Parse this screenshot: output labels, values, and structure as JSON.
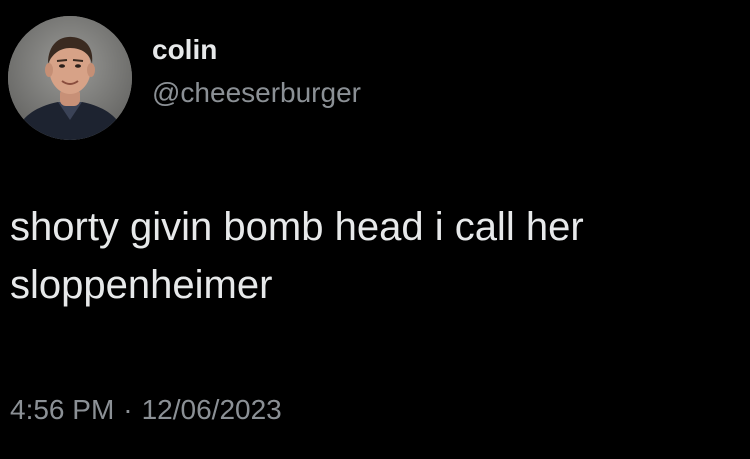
{
  "author": {
    "display_name": "colin",
    "handle": "@cheeserburger",
    "avatar_icon": "profile-photo"
  },
  "tweet": {
    "text_lines": [
      "shorty givin bomb head i call her",
      "sloppenheimer"
    ],
    "time": "4:56 PM",
    "separator": "·",
    "date": "12/06/2023"
  },
  "colors": {
    "background": "#000000",
    "primary_text": "#e7e9ea",
    "secondary_text": "#8b9095"
  }
}
